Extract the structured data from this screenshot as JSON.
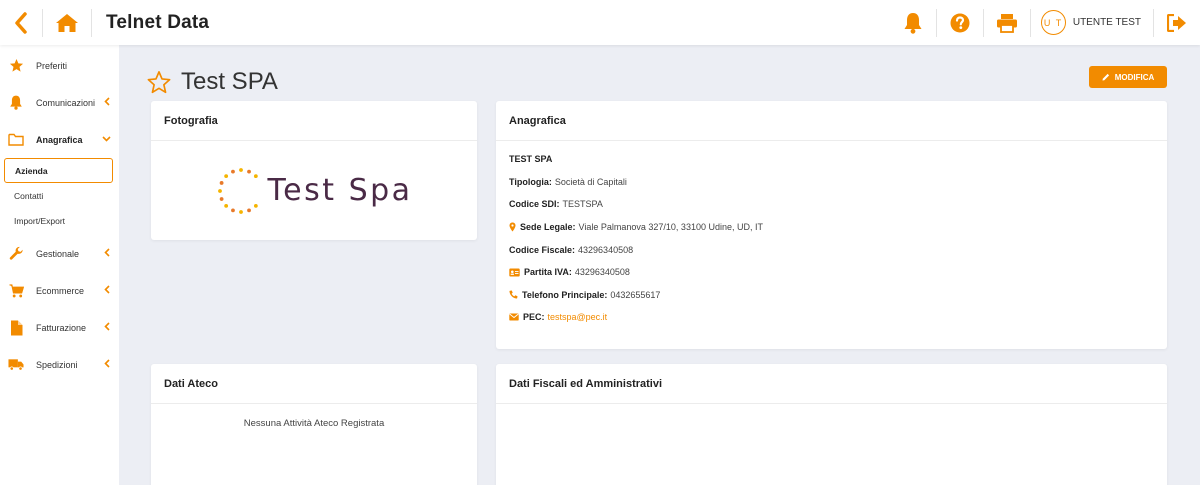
{
  "app": {
    "title": "Telnet Data",
    "accent": "#f28b00"
  },
  "user": {
    "initials": "U T",
    "name": "UTENTE TEST"
  },
  "sidebar": {
    "items": [
      {
        "label": "Preferiti",
        "icon": "star-icon"
      },
      {
        "label": "Comunicazioni",
        "icon": "bell-icon"
      },
      {
        "label": "Anagrafica",
        "icon": "folder-icon"
      },
      {
        "label": "Gestionale",
        "icon": "wrench-icon"
      },
      {
        "label": "Ecommerce",
        "icon": "cart-icon"
      },
      {
        "label": "Fatturazione",
        "icon": "file-icon"
      },
      {
        "label": "Spedizioni",
        "icon": "truck-icon"
      }
    ],
    "sub_items": [
      {
        "label": "Azienda",
        "active": true
      },
      {
        "label": "Contatti",
        "active": false
      },
      {
        "label": "Import/Export",
        "active": false
      }
    ]
  },
  "page": {
    "title": "Test SPA",
    "edit_label": "MODIFICA"
  },
  "cards": {
    "photo": {
      "title": "Fotografia",
      "logo_text": "Test Spa"
    },
    "anagrafica": {
      "title": "Anagrafica",
      "company": "TEST SPA",
      "rows": [
        {
          "label": "Tipologia:",
          "value": "Società di Capitali"
        },
        {
          "label": "Codice SDI:",
          "value": "TESTSPA"
        },
        {
          "label": "Sede Legale:",
          "value": "Viale Palmanova 327/10, 33100 Udine, UD, IT"
        },
        {
          "label": "Codice Fiscale:",
          "value": "43296340508"
        },
        {
          "label": "Partita IVA:",
          "value": "43296340508"
        },
        {
          "label": "Telefono Principale:",
          "value": "0432655617"
        },
        {
          "label": "PEC:",
          "value": "testspa@pec.it"
        }
      ]
    },
    "ateco": {
      "title": "Dati Ateco",
      "empty_message": "Nessuna Attività Ateco Registrata"
    },
    "fiscali": {
      "title": "Dati Fiscali ed Amministrativi"
    }
  }
}
